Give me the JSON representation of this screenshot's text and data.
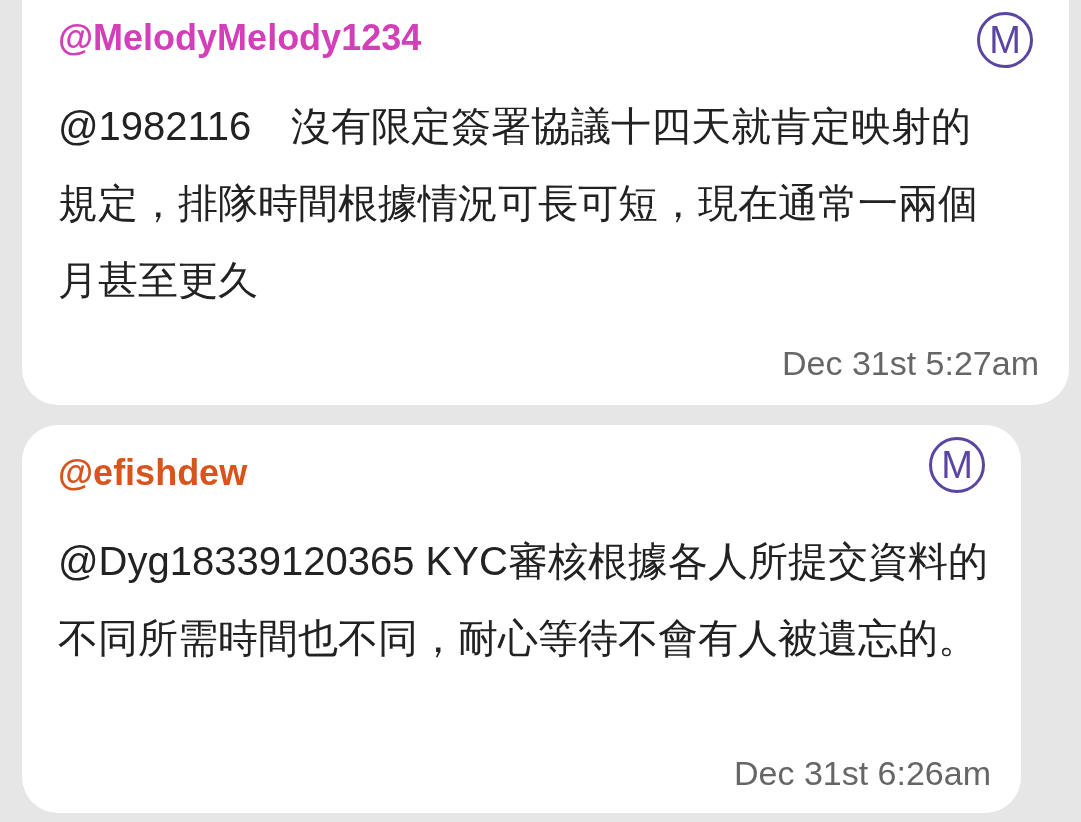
{
  "messages": [
    {
      "handle": "@MelodyMelody1234",
      "color": "#d23fb8",
      "badge": "M",
      "text": "@1982116　沒有限定簽署協議十四天就肯定映射的規定，排隊時間根據情況可長可短，現在通常一兩個月甚至更久",
      "time": "Dec 31st 5:27am"
    },
    {
      "handle": "@efishdew",
      "color": "#d9531c",
      "badge": "M",
      "text": "@Dyg18339120365 KYC審核根據各人所提交資料的不同所需時間也不同，耐心等待不會有人被遺忘的。",
      "time": "Dec 31st 6:26am"
    }
  ]
}
